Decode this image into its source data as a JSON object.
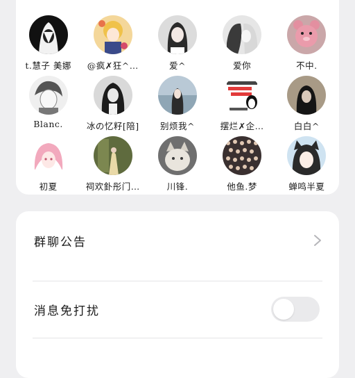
{
  "members": [
    {
      "name": "t.慧子 美娜",
      "avatar": "anime-hooded-girl-avatar"
    },
    {
      "name": "@疯✗狂^…",
      "avatar": "anime-blonde-girl-avatar"
    },
    {
      "name": "爱^",
      "avatar": "girl-photo-avatar"
    },
    {
      "name": "爱你",
      "avatar": "anime-couple-avatar"
    },
    {
      "name": "不中.",
      "avatar": "pink-bear-avatar"
    },
    {
      "name": "Blanc.",
      "avatar": "anime-boy-sketch-avatar"
    },
    {
      "name": "冰の忆籽[陪]",
      "avatar": "anime-dark-boy-avatar"
    },
    {
      "name": "别烦我^",
      "avatar": "girl-beach-avatar"
    },
    {
      "name": "摆烂✗企…",
      "avatar": "penguin-meme-avatar"
    },
    {
      "name": "白白^",
      "avatar": "girl-dark-photo-avatar"
    },
    {
      "name": "初夏",
      "avatar": "anime-pink-hair-girl-avatar"
    },
    {
      "name": "祠欢釙彤门…",
      "avatar": "girl-dress-avatar"
    },
    {
      "name": "川锋.",
      "avatar": "cat-avatar"
    },
    {
      "name": "他鱼.梦",
      "avatar": "crowd-avatar"
    },
    {
      "name": "蝉鸣半夏",
      "avatar": "anime-cat-ear-girl-avatar"
    }
  ],
  "settings": {
    "announcement_label": "群聊公告",
    "mute_label": "消息免打扰",
    "mute_enabled": false
  }
}
